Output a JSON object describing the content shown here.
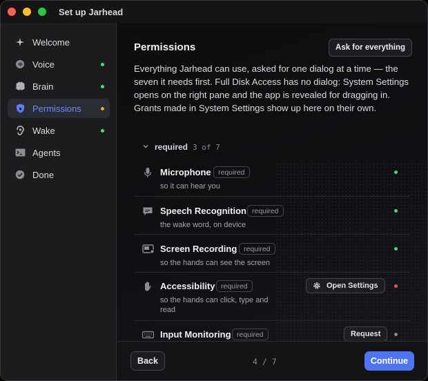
{
  "window": {
    "title": "Set up Jarhead"
  },
  "colors": {
    "accent": "#4f74f0",
    "ok": "#4fd67a",
    "pending": "#f5a623",
    "error": "#f0505a",
    "neutral": "#8a8a90"
  },
  "sidebar": {
    "items": [
      {
        "label": "Welcome",
        "icon": "sparkle-icon",
        "status": "none"
      },
      {
        "label": "Voice",
        "icon": "voice-icon",
        "status": "ok"
      },
      {
        "label": "Brain",
        "icon": "brain-icon",
        "status": "ok"
      },
      {
        "label": "Permissions",
        "icon": "shield-icon",
        "status": "pending",
        "active": true
      },
      {
        "label": "Wake",
        "icon": "ear-icon",
        "status": "ok"
      },
      {
        "label": "Agents",
        "icon": "terminal-icon",
        "status": "none"
      },
      {
        "label": "Done",
        "icon": "check-circle-icon",
        "status": "none"
      }
    ]
  },
  "main": {
    "title": "Permissions",
    "ask_button": "Ask for everything",
    "description": "Everything Jarhead can use, asked for one dialog at a time — the seven it needs first. Full Disk Access has no dialog: System Settings opens on the right pane and the app is revealed for dragging in. Grants made in System Settings show up here on their own.",
    "group": {
      "label": "required",
      "count": "3 of 7"
    },
    "permissions": [
      {
        "title": "Microphone",
        "badge": "required",
        "subtitle": "so it can hear you",
        "icon": "microphone-icon",
        "status": "ok"
      },
      {
        "title": "Speech Recognition",
        "badge": "required",
        "subtitle": "the wake word, on device",
        "icon": "speech-bubble-icon",
        "status": "ok"
      },
      {
        "title": "Screen Recording",
        "badge": "required",
        "subtitle": "so the hands can see the screen",
        "icon": "screen-icon",
        "status": "ok"
      },
      {
        "title": "Accessibility",
        "badge": "required",
        "subtitle": "so the hands can click, type and read",
        "icon": "hand-icon",
        "status": "error",
        "action": "Open Settings",
        "action_icon": "gear-icon"
      },
      {
        "title": "Input Monitoring",
        "badge": "required",
        "subtitle": "",
        "icon": "keyboard-icon",
        "status": "neutral",
        "action": "Request"
      }
    ]
  },
  "footer": {
    "back": "Back",
    "pager": "4 / 7",
    "continue": "Continue"
  }
}
